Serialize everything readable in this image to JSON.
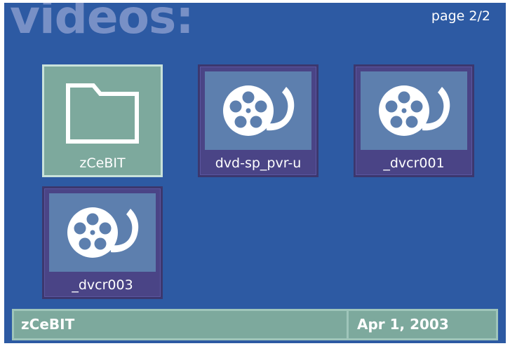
{
  "screen": {
    "title": "videos:",
    "page_indicator": "page 2/2"
  },
  "items": [
    {
      "label": "zCeBIT",
      "icon": "folder-icon",
      "selected": true
    },
    {
      "label": "dvd-sp_pvr-u",
      "icon": "film-reel-icon",
      "selected": false
    },
    {
      "label": "_dvcr001",
      "icon": "film-reel-icon",
      "selected": false
    },
    {
      "label": "_dvcr003",
      "icon": "film-reel-icon",
      "selected": false
    }
  ],
  "status_bar": {
    "name": "zCeBIT",
    "date": "Apr 1, 2003"
  },
  "colors": {
    "background": "#2d5aa3",
    "tile": "#4a4486",
    "thumb": "#5d7fae",
    "selected": "#7da99d",
    "title": "#7890c6"
  }
}
